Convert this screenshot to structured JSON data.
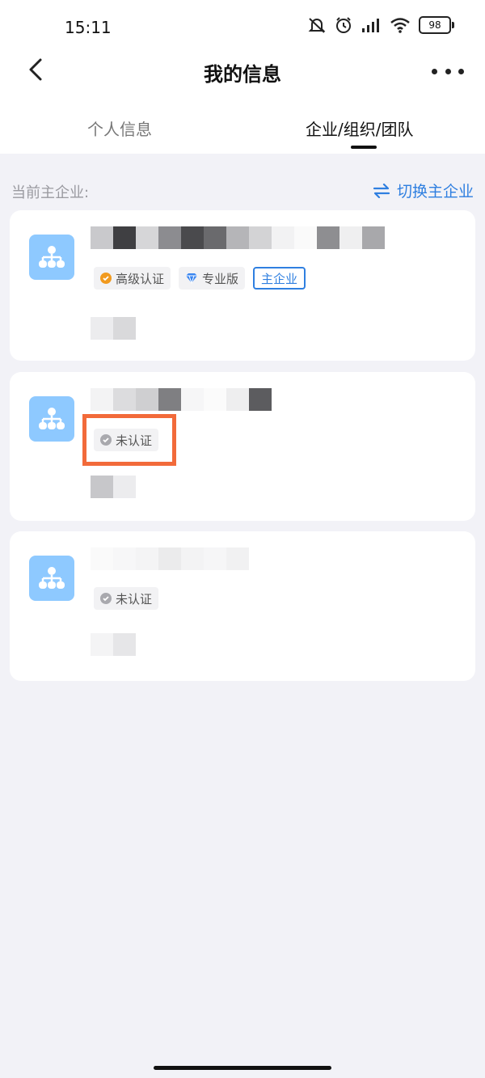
{
  "status_bar": {
    "time": "15:11",
    "battery": "98"
  },
  "nav": {
    "title": "我的信息",
    "back_icon": "chevron-left-icon",
    "more_icon": "more-horizontal-icon"
  },
  "tabs": [
    {
      "label": "个人信息",
      "active": false
    },
    {
      "label": "企业/组织/团队",
      "active": true
    }
  ],
  "section": {
    "current_label": "当前主企业:",
    "switch_label": "切换主企业",
    "accent": "#2f7fe0"
  },
  "orgs": [
    {
      "tags": [
        {
          "label": "高级认证",
          "icon": "verified-badge-icon"
        },
        {
          "label": "专业版",
          "icon": "diamond-icon"
        },
        {
          "label": "主企业",
          "icon": ""
        }
      ]
    },
    {
      "tags": [
        {
          "label": "未认证",
          "icon": "unverified-check-icon"
        }
      ]
    },
    {
      "tags": [
        {
          "label": "未认证",
          "icon": "unverified-check-icon"
        }
      ]
    }
  ],
  "colors": {
    "highlight": "#f26a3a",
    "avatar_bg": "#8ec9ff",
    "page_bg": "#f2f2f7"
  }
}
